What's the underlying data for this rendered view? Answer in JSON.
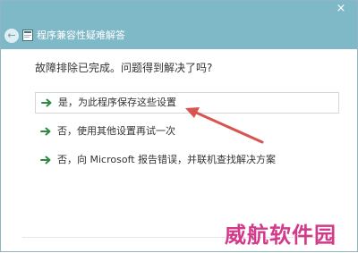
{
  "window": {
    "close_glyph": "×",
    "title": "程序兼容性疑难解答"
  },
  "content": {
    "heading": "故障排除已完成。问题得到解决了吗?",
    "options": [
      {
        "label": "是，为此程序保存这些设置"
      },
      {
        "label": "否，使用其他设置再试一次"
      },
      {
        "label": "否，向 Microsoft 报告错误，并联机查找解决方案"
      }
    ]
  },
  "watermark": {
    "text": "威航软件园"
  },
  "colors": {
    "title_bar": "#7fb8c6",
    "option_arrow": "#2e8b3d",
    "annotation_arrow": "#d9534f",
    "watermark": "#d23a8a"
  },
  "icons": [
    "close-icon",
    "back-arrow-icon",
    "program-icon",
    "green-arrow-icon",
    "red-annotation-arrow"
  ]
}
